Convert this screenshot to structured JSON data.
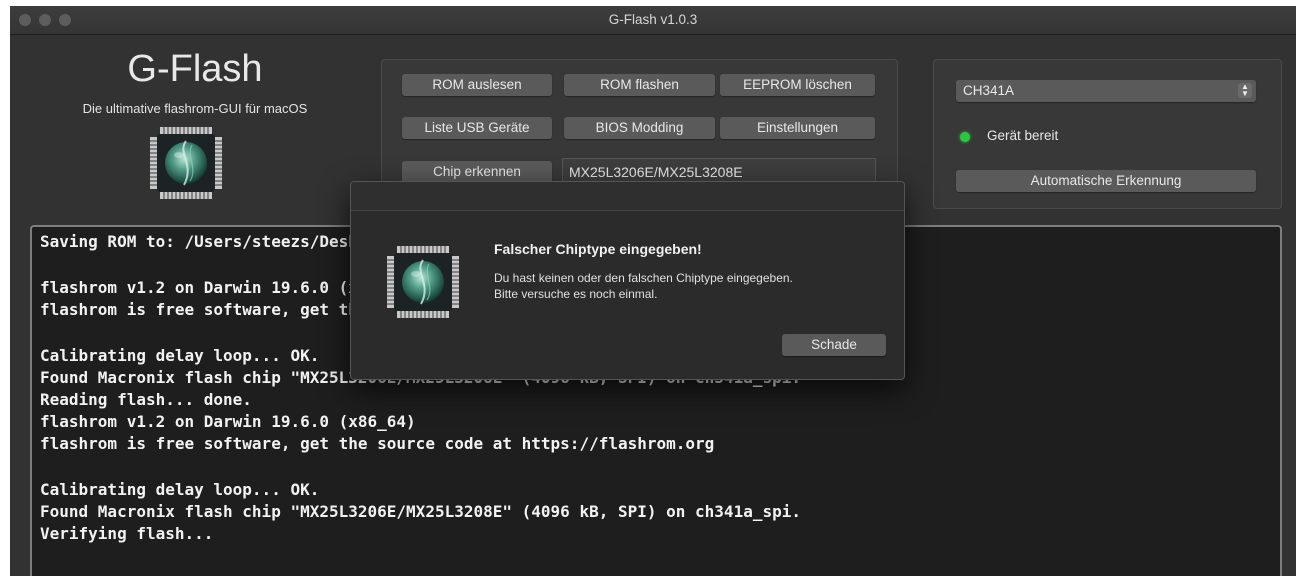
{
  "window": {
    "title": "G-Flash v1.0.3"
  },
  "brand": {
    "title": "G-Flash",
    "subtitle": "Die ultimative flashrom-GUI für macOS",
    "logo_icon": "chip-logo-icon"
  },
  "toolbar": {
    "rom_read": "ROM auslesen",
    "rom_flash": "ROM flashen",
    "eeprom_erase": "EEPROM löschen",
    "usb_list": "Liste USB Geräte",
    "bios_modding": "BIOS Modding",
    "settings": "Einstellungen",
    "detect_chip": "Chip erkennen",
    "chip_value": "MX25L3206E/MX25L3208E"
  },
  "device": {
    "programmer_selected": "CH341A",
    "status_text": "Gerät bereit",
    "status_color": "#28c940",
    "auto_detect": "Automatische Erkennung"
  },
  "console": {
    "lines": [
      "Saving ROM to: /Users/steezs/Desktop/ROM/ROM.bin",
      "",
      "flashrom v1.2 on Darwin 19.6.0 (x86_64)",
      "flashrom is free software, get the source code at https://flashrom.org",
      "",
      "Calibrating delay loop... OK.",
      "Found Macronix flash chip \"MX25L3206E/MX25L3208E\" (4096 kB, SPI) on ch341a_spi.",
      "Reading flash... done.",
      "flashrom v1.2 on Darwin 19.6.0 (x86_64)",
      "flashrom is free software, get the source code at https://flashrom.org",
      "",
      "Calibrating delay loop... OK.",
      "Found Macronix flash chip \"MX25L3206E/MX25L3208E\" (4096 kB, SPI) on ch341a_spi.",
      "Verifying flash..."
    ]
  },
  "dialog": {
    "title": "Falscher Chiptype eingegeben!",
    "message_line1": "Du hast keinen oder den falschen Chiptype eingegeben.",
    "message_line2": "Bitte versuche es noch einmal.",
    "button": "Schade"
  }
}
